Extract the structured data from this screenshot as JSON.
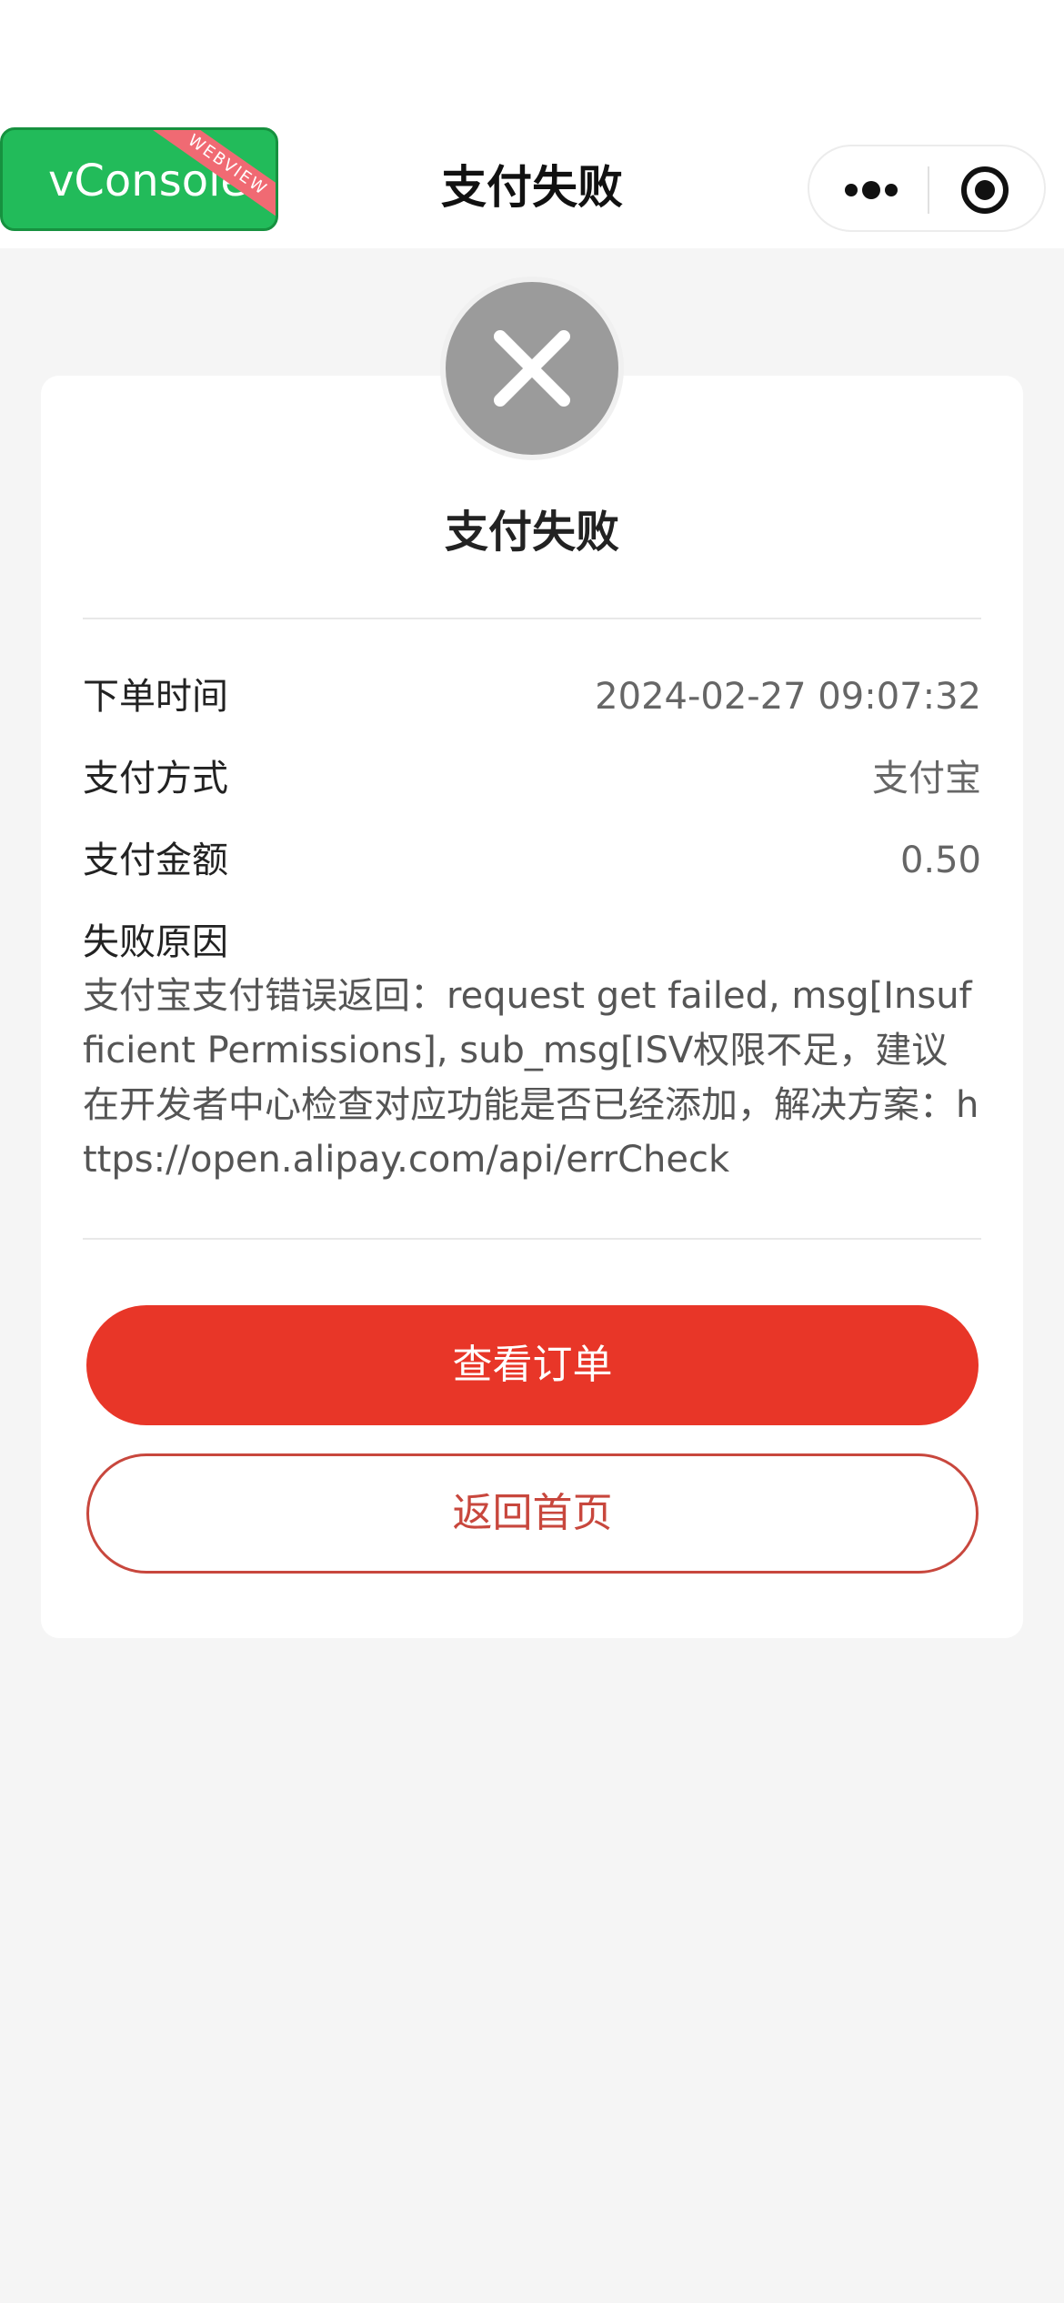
{
  "navbar": {
    "title": "支付失败",
    "vconsole_label": "vConsole",
    "webview_badge": "WEBVIEW",
    "more_icon": "more-dots-icon",
    "close_icon": "target-circle-icon"
  },
  "result": {
    "status_icon": "close-x-icon",
    "title": "支付失败"
  },
  "details": {
    "order_time": {
      "label": "下单时间",
      "value": "2024-02-27 09:07:32"
    },
    "pay_method": {
      "label": "支付方式",
      "value": "支付宝"
    },
    "pay_amount": {
      "label": "支付金额",
      "value": "0.50"
    },
    "fail_reason": {
      "label": "失败原因",
      "value": "支付宝支付错误返回：request get failed, msg[Insufficient Permissions], sub_msg[ISV权限不足，建议在开发者中心检查对应功能是否已经添加，解决方案：https://open.alipay.com/api/errCheck"
    }
  },
  "actions": {
    "view_order": "查看订单",
    "back_home": "返回首页"
  },
  "colors": {
    "primary": "#e83628",
    "outline": "#c8473d",
    "vconsole": "#22bb5a",
    "fail_icon_bg": "#9b9b9b"
  }
}
